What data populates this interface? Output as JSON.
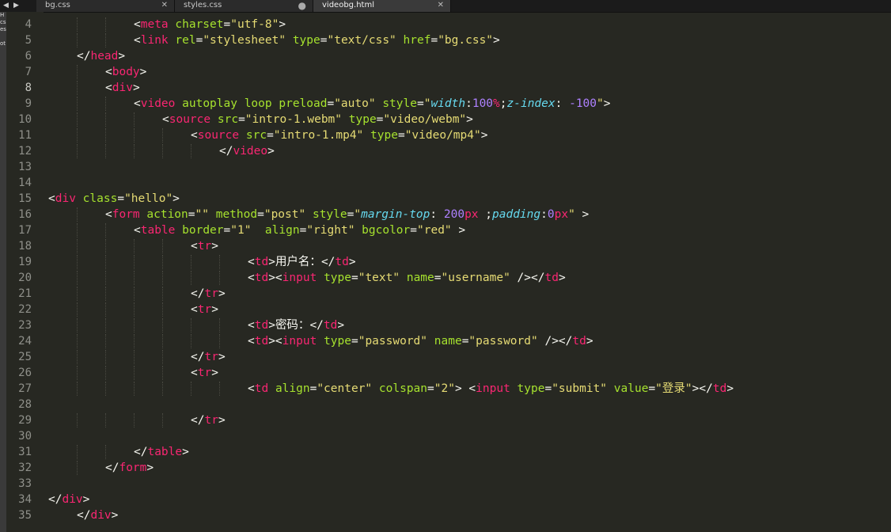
{
  "tabs": [
    {
      "label": "bg.css",
      "state": "close"
    },
    {
      "label": "styles.css",
      "state": "modified"
    },
    {
      "label": "videobg.html",
      "state": "close",
      "active": true
    }
  ],
  "sidebar_fragment": [
    "H",
    "cs",
    "es",
    "ot"
  ],
  "colors": {
    "background": "#272822",
    "tag": "#f92672",
    "attribute": "#a6e22e",
    "string": "#e6db74",
    "css_property": "#66d9ef",
    "number": "#ae81ff",
    "plain": "#f8f8f2",
    "line_number": "#8f908a"
  },
  "current_line": 8,
  "lines": [
    {
      "n": "4",
      "indent": 3,
      "tokens": [
        [
          "p",
          "<"
        ],
        [
          "t",
          "meta"
        ],
        [
          "p",
          " "
        ],
        [
          "a",
          "charset"
        ],
        [
          "p",
          "="
        ],
        [
          "s",
          "\"utf-8\""
        ],
        [
          "p",
          ">"
        ]
      ]
    },
    {
      "n": "5",
      "indent": 3,
      "tokens": [
        [
          "p",
          "<"
        ],
        [
          "t",
          "link"
        ],
        [
          "p",
          " "
        ],
        [
          "a",
          "rel"
        ],
        [
          "p",
          "="
        ],
        [
          "s",
          "\"stylesheet\""
        ],
        [
          "p",
          " "
        ],
        [
          "a",
          "type"
        ],
        [
          "p",
          "="
        ],
        [
          "s",
          "\"text/css\""
        ],
        [
          "p",
          " "
        ],
        [
          "a",
          "href"
        ],
        [
          "p",
          "="
        ],
        [
          "s",
          "\"bg.css\""
        ],
        [
          "p",
          ">"
        ]
      ]
    },
    {
      "n": "6",
      "indent": 1,
      "tokens": [
        [
          "p",
          "</"
        ],
        [
          "t",
          "head"
        ],
        [
          "p",
          ">"
        ]
      ]
    },
    {
      "n": "7",
      "indent": 2,
      "tokens": [
        [
          "p",
          "<"
        ],
        [
          "t",
          "body"
        ],
        [
          "p",
          ">"
        ]
      ]
    },
    {
      "n": "8",
      "indent": 2,
      "tokens": [
        [
          "p",
          "<"
        ],
        [
          "t",
          "div"
        ],
        [
          "p",
          ">"
        ]
      ]
    },
    {
      "n": "9",
      "indent": 3,
      "tokens": [
        [
          "p",
          "<"
        ],
        [
          "t",
          "video"
        ],
        [
          "p",
          " "
        ],
        [
          "a",
          "autoplay"
        ],
        [
          "p",
          " "
        ],
        [
          "a",
          "loop"
        ],
        [
          "p",
          " "
        ],
        [
          "a",
          "preload"
        ],
        [
          "p",
          "="
        ],
        [
          "s",
          "\"auto\""
        ],
        [
          "p",
          " "
        ],
        [
          "a",
          "style"
        ],
        [
          "p",
          "="
        ],
        [
          "s",
          "\""
        ],
        [
          "cp",
          "width"
        ],
        [
          "p",
          ":"
        ],
        [
          "n",
          "100"
        ],
        [
          "k",
          "%"
        ],
        [
          "p",
          ";"
        ],
        [
          "cp",
          "z-index"
        ],
        [
          "p",
          ": "
        ],
        [
          "n",
          "-100"
        ],
        [
          "s",
          "\""
        ],
        [
          "p",
          ">"
        ]
      ]
    },
    {
      "n": "10",
      "indent": 4,
      "tokens": [
        [
          "p",
          "<"
        ],
        [
          "t",
          "source"
        ],
        [
          "p",
          " "
        ],
        [
          "a",
          "src"
        ],
        [
          "p",
          "="
        ],
        [
          "s",
          "\"intro-1.webm\""
        ],
        [
          "p",
          " "
        ],
        [
          "a",
          "type"
        ],
        [
          "p",
          "="
        ],
        [
          "s",
          "\"video/webm\""
        ],
        [
          "p",
          ">"
        ]
      ]
    },
    {
      "n": "11",
      "indent": 5,
      "tokens": [
        [
          "p",
          "<"
        ],
        [
          "t",
          "source"
        ],
        [
          "p",
          " "
        ],
        [
          "a",
          "src"
        ],
        [
          "p",
          "="
        ],
        [
          "s",
          "\"intro-1.mp4\""
        ],
        [
          "p",
          " "
        ],
        [
          "a",
          "type"
        ],
        [
          "p",
          "="
        ],
        [
          "s",
          "\"video/mp4\""
        ],
        [
          "p",
          ">"
        ]
      ]
    },
    {
      "n": "12",
      "indent": 6,
      "tokens": [
        [
          "p",
          "</"
        ],
        [
          "t",
          "video"
        ],
        [
          "p",
          ">"
        ]
      ]
    },
    {
      "n": "13",
      "indent": 0,
      "tokens": []
    },
    {
      "n": "14",
      "indent": 0,
      "tokens": []
    },
    {
      "n": "15",
      "indent": 0,
      "tokens": [
        [
          "p",
          "<"
        ],
        [
          "t",
          "div"
        ],
        [
          "p",
          " "
        ],
        [
          "a",
          "class"
        ],
        [
          "p",
          "="
        ],
        [
          "s",
          "\"hello\""
        ],
        [
          "p",
          ">"
        ]
      ]
    },
    {
      "n": "16",
      "indent": 2,
      "tokens": [
        [
          "p",
          "<"
        ],
        [
          "t",
          "form"
        ],
        [
          "p",
          " "
        ],
        [
          "a",
          "action"
        ],
        [
          "p",
          "="
        ],
        [
          "s",
          "\"\""
        ],
        [
          "p",
          " "
        ],
        [
          "a",
          "method"
        ],
        [
          "p",
          "="
        ],
        [
          "s",
          "\"post\""
        ],
        [
          "p",
          " "
        ],
        [
          "a",
          "style"
        ],
        [
          "p",
          "="
        ],
        [
          "s",
          "\""
        ],
        [
          "cp",
          "margin-top"
        ],
        [
          "p",
          ": "
        ],
        [
          "n",
          "200"
        ],
        [
          "k",
          "px"
        ],
        [
          "p",
          " ;"
        ],
        [
          "cp",
          "padding"
        ],
        [
          "p",
          ":"
        ],
        [
          "n",
          "0"
        ],
        [
          "k",
          "px"
        ],
        [
          "s",
          "\""
        ],
        [
          "p",
          " >"
        ]
      ]
    },
    {
      "n": "17",
      "indent": 3,
      "tokens": [
        [
          "p",
          "<"
        ],
        [
          "t",
          "table"
        ],
        [
          "p",
          " "
        ],
        [
          "a",
          "border"
        ],
        [
          "p",
          "="
        ],
        [
          "s",
          "\"1\""
        ],
        [
          "p",
          "  "
        ],
        [
          "a",
          "align"
        ],
        [
          "p",
          "="
        ],
        [
          "s",
          "\"right\""
        ],
        [
          "p",
          " "
        ],
        [
          "a",
          "bgcolor"
        ],
        [
          "p",
          "="
        ],
        [
          "s",
          "\"red\""
        ],
        [
          "p",
          " >"
        ]
      ]
    },
    {
      "n": "18",
      "indent": 5,
      "tokens": [
        [
          "p",
          "<"
        ],
        [
          "t",
          "tr"
        ],
        [
          "p",
          ">"
        ]
      ]
    },
    {
      "n": "19",
      "indent": 7,
      "tokens": [
        [
          "p",
          "<"
        ],
        [
          "t",
          "td"
        ],
        [
          "p",
          ">"
        ],
        [
          "txt",
          "用户名："
        ],
        [
          "p",
          "</"
        ],
        [
          "t",
          "td"
        ],
        [
          "p",
          ">"
        ]
      ]
    },
    {
      "n": "20",
      "indent": 7,
      "tokens": [
        [
          "p",
          "<"
        ],
        [
          "t",
          "td"
        ],
        [
          "p",
          "><"
        ],
        [
          "t",
          "input"
        ],
        [
          "p",
          " "
        ],
        [
          "a",
          "type"
        ],
        [
          "p",
          "="
        ],
        [
          "s",
          "\"text\""
        ],
        [
          "p",
          " "
        ],
        [
          "a",
          "name"
        ],
        [
          "p",
          "="
        ],
        [
          "s",
          "\"username\""
        ],
        [
          "p",
          " /></"
        ],
        [
          "t",
          "td"
        ],
        [
          "p",
          ">"
        ]
      ]
    },
    {
      "n": "21",
      "indent": 5,
      "tokens": [
        [
          "p",
          "</"
        ],
        [
          "t",
          "tr"
        ],
        [
          "p",
          ">"
        ]
      ]
    },
    {
      "n": "22",
      "indent": 5,
      "tokens": [
        [
          "p",
          "<"
        ],
        [
          "t",
          "tr"
        ],
        [
          "p",
          ">"
        ]
      ]
    },
    {
      "n": "23",
      "indent": 7,
      "tokens": [
        [
          "p",
          "<"
        ],
        [
          "t",
          "td"
        ],
        [
          "p",
          ">"
        ],
        [
          "txt",
          "密码："
        ],
        [
          "p",
          "</"
        ],
        [
          "t",
          "td"
        ],
        [
          "p",
          ">"
        ]
      ]
    },
    {
      "n": "24",
      "indent": 7,
      "tokens": [
        [
          "p",
          "<"
        ],
        [
          "t",
          "td"
        ],
        [
          "p",
          "><"
        ],
        [
          "t",
          "input"
        ],
        [
          "p",
          " "
        ],
        [
          "a",
          "type"
        ],
        [
          "p",
          "="
        ],
        [
          "s",
          "\"password\""
        ],
        [
          "p",
          " "
        ],
        [
          "a",
          "name"
        ],
        [
          "p",
          "="
        ],
        [
          "s",
          "\"password\""
        ],
        [
          "p",
          " /></"
        ],
        [
          "t",
          "td"
        ],
        [
          "p",
          ">"
        ]
      ]
    },
    {
      "n": "25",
      "indent": 5,
      "tokens": [
        [
          "p",
          "</"
        ],
        [
          "t",
          "tr"
        ],
        [
          "p",
          ">"
        ]
      ]
    },
    {
      "n": "26",
      "indent": 5,
      "tokens": [
        [
          "p",
          "<"
        ],
        [
          "t",
          "tr"
        ],
        [
          "p",
          ">"
        ]
      ]
    },
    {
      "n": "27",
      "indent": 7,
      "tokens": [
        [
          "p",
          "<"
        ],
        [
          "t",
          "td"
        ],
        [
          "p",
          " "
        ],
        [
          "a",
          "align"
        ],
        [
          "p",
          "="
        ],
        [
          "s",
          "\"center\""
        ],
        [
          "p",
          " "
        ],
        [
          "a",
          "colspan"
        ],
        [
          "p",
          "="
        ],
        [
          "s",
          "\"2\""
        ],
        [
          "p",
          "> <"
        ],
        [
          "t",
          "input"
        ],
        [
          "p",
          " "
        ],
        [
          "a",
          "type"
        ],
        [
          "p",
          "="
        ],
        [
          "s",
          "\"submit\""
        ],
        [
          "p",
          " "
        ],
        [
          "a",
          "value"
        ],
        [
          "p",
          "="
        ],
        [
          "s",
          "\"登录\""
        ],
        [
          "p",
          "></"
        ],
        [
          "t",
          "td"
        ],
        [
          "p",
          ">"
        ]
      ]
    },
    {
      "n": "28",
      "indent": 0,
      "tokens": []
    },
    {
      "n": "29",
      "indent": 5,
      "tokens": [
        [
          "p",
          "</"
        ],
        [
          "t",
          "tr"
        ],
        [
          "p",
          ">"
        ]
      ]
    },
    {
      "n": "30",
      "indent": 0,
      "tokens": []
    },
    {
      "n": "31",
      "indent": 3,
      "tokens": [
        [
          "p",
          "</"
        ],
        [
          "t",
          "table"
        ],
        [
          "p",
          ">"
        ]
      ]
    },
    {
      "n": "32",
      "indent": 2,
      "tokens": [
        [
          "p",
          "</"
        ],
        [
          "t",
          "form"
        ],
        [
          "p",
          ">"
        ]
      ]
    },
    {
      "n": "33",
      "indent": 0,
      "tokens": []
    },
    {
      "n": "34",
      "indent": 0,
      "tokens": [
        [
          "p",
          "</"
        ],
        [
          "t",
          "div"
        ],
        [
          "p",
          ">"
        ]
      ]
    },
    {
      "n": "35",
      "indent": 1,
      "tokens": [
        [
          "p",
          "</"
        ],
        [
          "t",
          "div"
        ],
        [
          "p",
          ">"
        ]
      ]
    }
  ]
}
